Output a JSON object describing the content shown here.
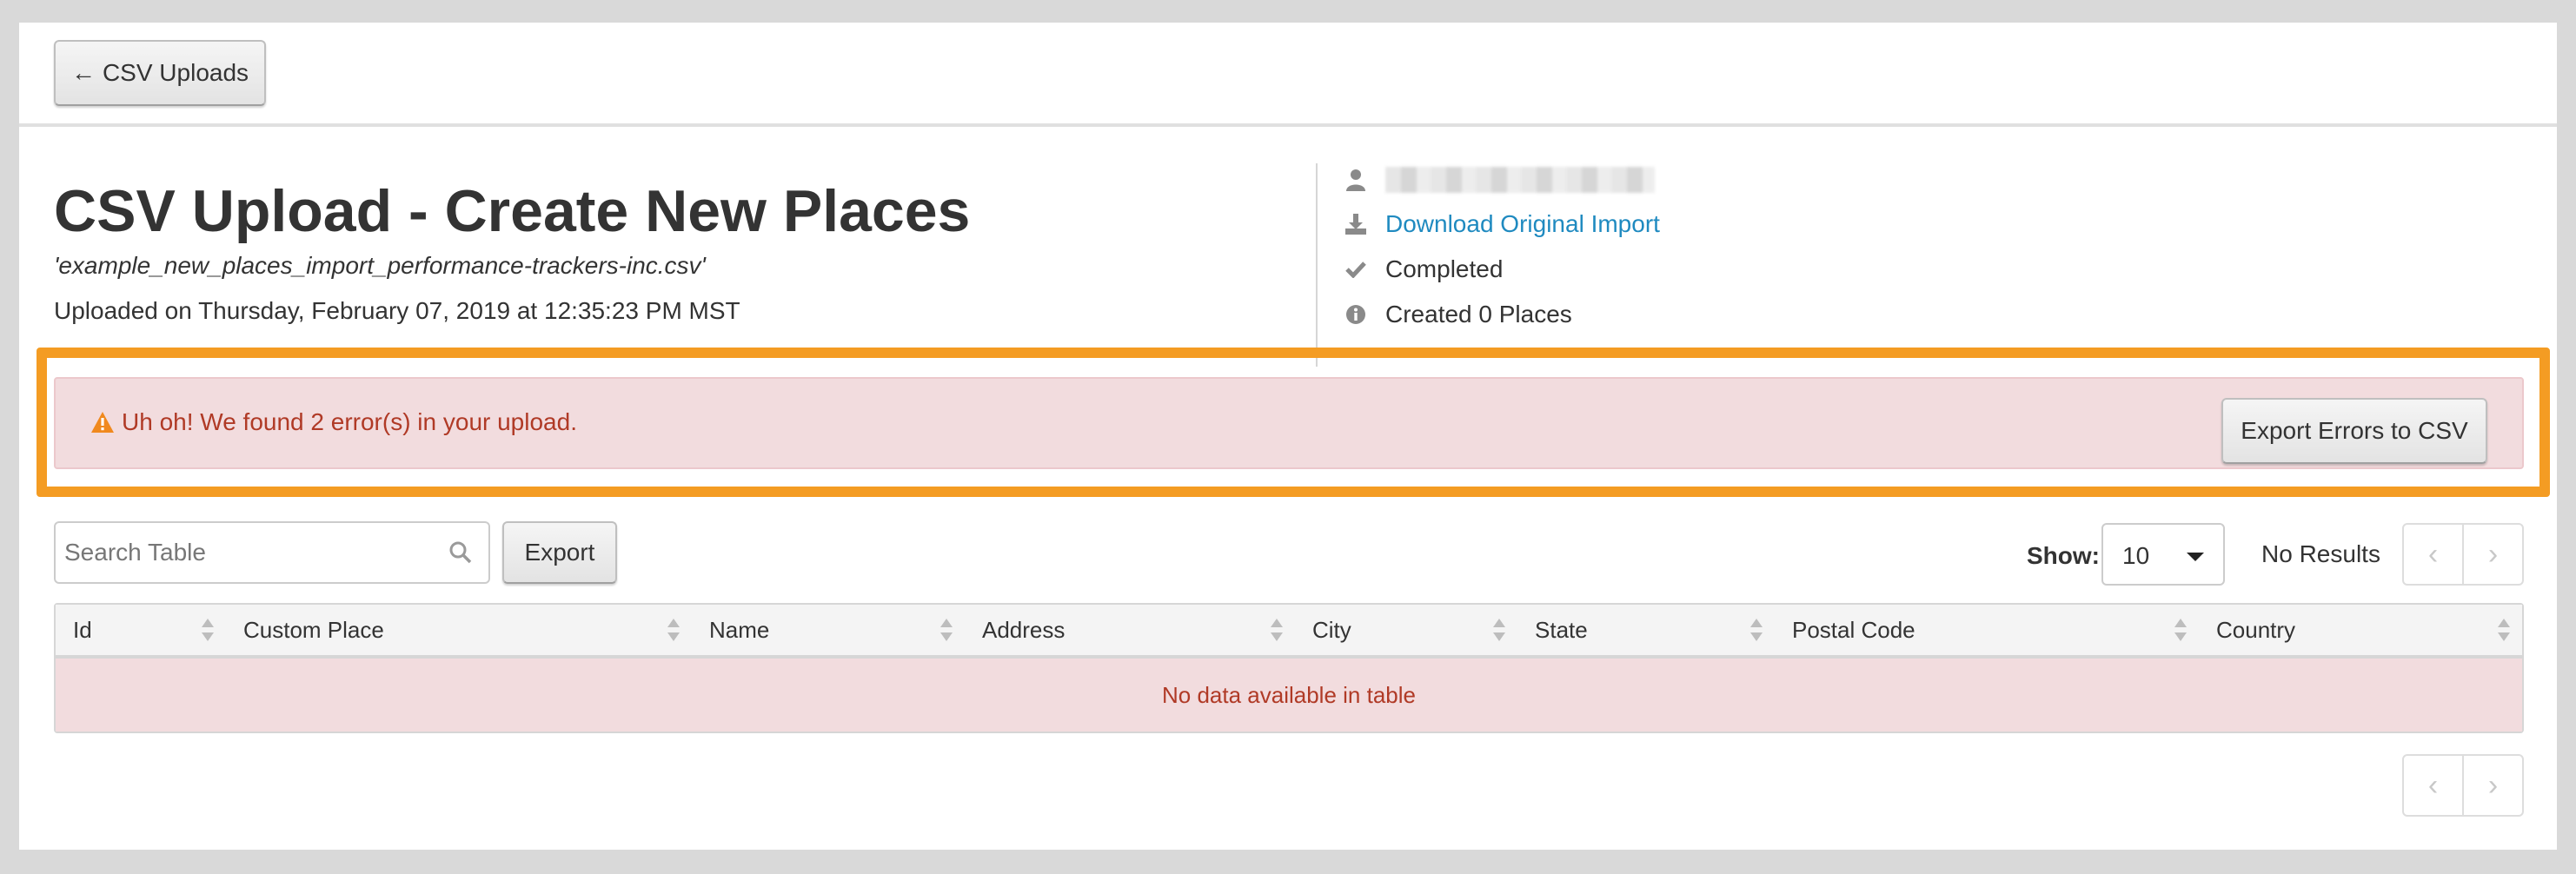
{
  "toolbar": {
    "back_label": "CSV Uploads"
  },
  "header": {
    "title": "CSV Upload - Create New Places",
    "filename": "'example_new_places_import_performance-trackers-inc.csv'",
    "uploaded": "Uploaded on Thursday, February 07, 2019 at 12:35:23 PM MST"
  },
  "meta": {
    "download_label": "Download Original Import",
    "status": "Completed",
    "created": "Created 0 Places"
  },
  "alert": {
    "message": "Uh oh! We found 2 error(s) in your upload.",
    "export_errors_label": "Export Errors to CSV"
  },
  "table_controls": {
    "search_placeholder": "Search Table",
    "export_label": "Export",
    "show_label": "Show:",
    "show_value": "10",
    "results_text": "No Results"
  },
  "table": {
    "columns": [
      "Id",
      "Custom Place",
      "Name",
      "Address",
      "City",
      "State",
      "Postal Code",
      "Country"
    ],
    "empty_message": "No data available in table"
  },
  "colors": {
    "highlight": "#f49c23",
    "alert_bg": "#f2dcde",
    "alert_text": "#b03a26",
    "link": "#1f8ac0",
    "warning_icon": "#f0891e"
  },
  "icons": [
    "arrow-left-icon",
    "user-icon",
    "download-icon",
    "check-icon",
    "info-icon",
    "warning-icon",
    "search-icon",
    "chevron-left-icon",
    "chevron-right-icon",
    "caret-down-icon"
  ]
}
